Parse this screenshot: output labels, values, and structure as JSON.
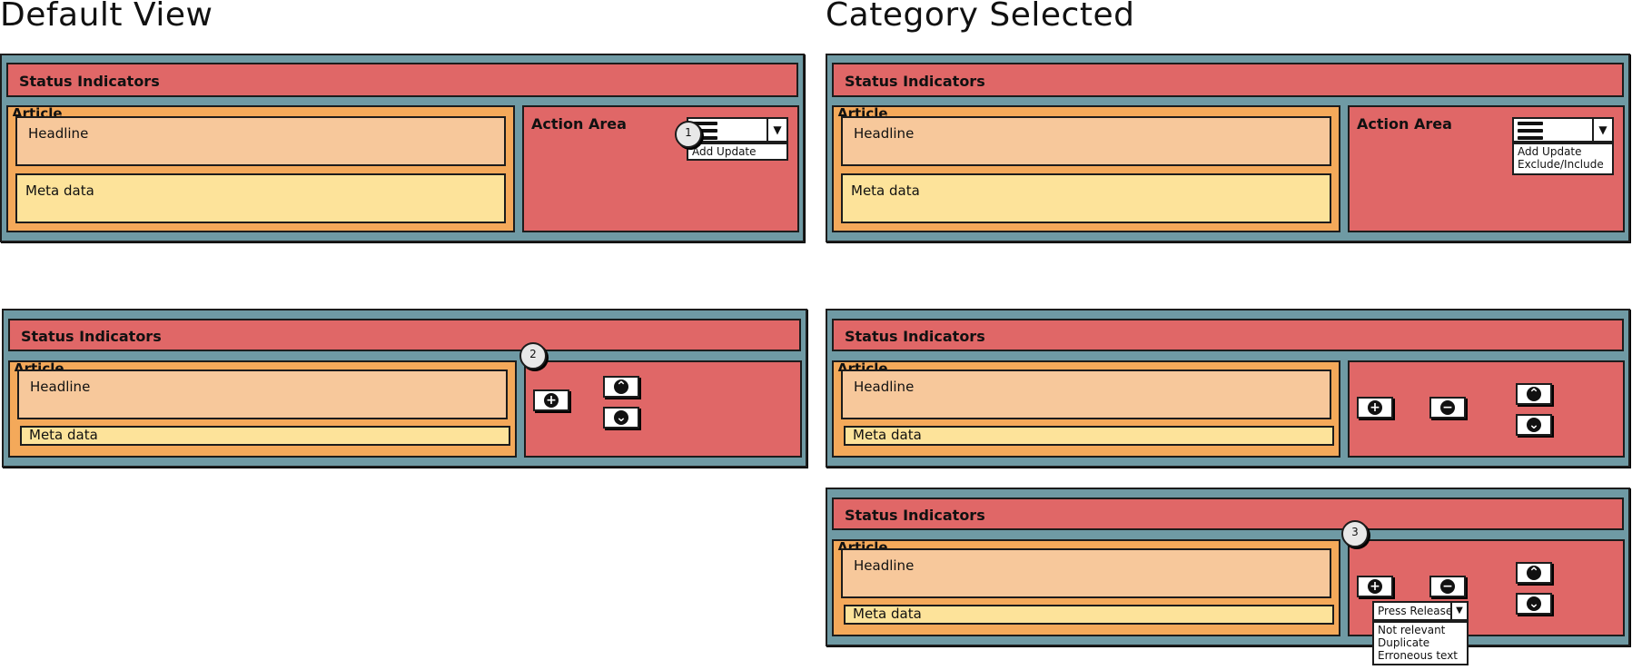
{
  "titles": {
    "default_view": "Default View",
    "category_selected": "Category Selected"
  },
  "common": {
    "status_label": "Status Indicators",
    "article_label": "Article",
    "headline_label": "Headline",
    "meta_label": "Meta data",
    "action_area_label": "Action Area"
  },
  "panel1": {
    "callout": "1",
    "menu_items": [
      "Add Update"
    ]
  },
  "panel2": {
    "callout": "2"
  },
  "panel3": {
    "menu_items": [
      "Add Update",
      "Exclude/Include"
    ]
  },
  "panel5": {
    "callout": "3",
    "select_value": "Press Release",
    "select_options": [
      "Not relevant",
      "Duplicate",
      "Erroneous text"
    ]
  },
  "icons": {
    "plus": "+",
    "minus": "−",
    "up": "⌃",
    "down": "⌄",
    "dropdown_arrow": "▼"
  },
  "colors": {
    "frame": "#6f9aa4",
    "status": "#e06767",
    "article": "#f4a95a",
    "headline": "#f7c89b",
    "meta": "#fde39a"
  }
}
